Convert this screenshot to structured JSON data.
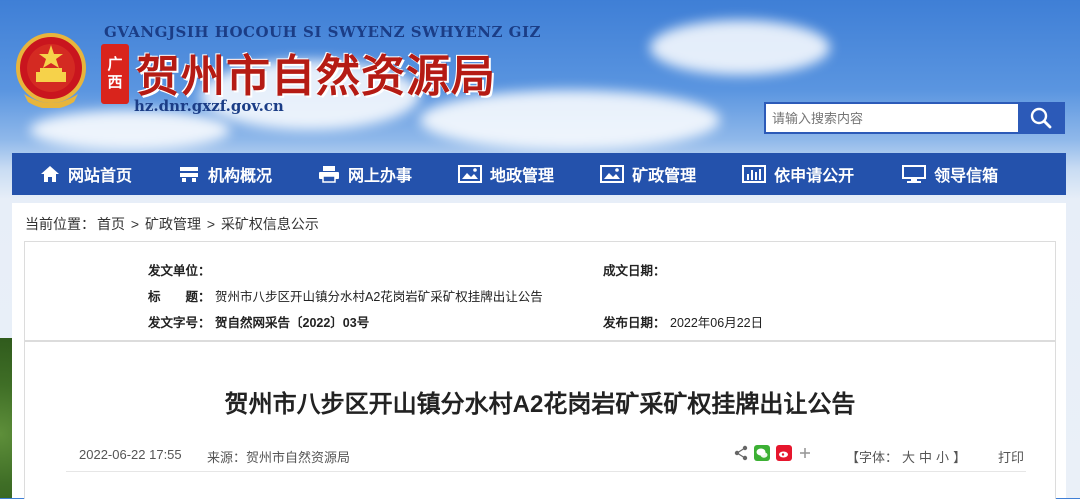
{
  "header": {
    "pinyin": "GVANGJSIH HOCOUH SI SWYENZ SWHYENZ GIZ",
    "province_tag": [
      "广",
      "西"
    ],
    "title": "贺州市自然资源局",
    "domain": "hz.dnr.gxzf.gov.cn"
  },
  "search": {
    "placeholder": "请输入搜索内容"
  },
  "nav": {
    "items": [
      {
        "label": "网站首页",
        "icon": "home-icon"
      },
      {
        "label": "机构概况",
        "icon": "building-icon"
      },
      {
        "label": "网上办事",
        "icon": "printer-icon"
      },
      {
        "label": "地政管理",
        "icon": "picture-icon"
      },
      {
        "label": "矿政管理",
        "icon": "picture-icon"
      },
      {
        "label": "依申请公开",
        "icon": "bar-chart-icon"
      },
      {
        "label": "领导信箱",
        "icon": "monitor-icon"
      }
    ]
  },
  "breadcrumb": {
    "prefix": "当前位置：",
    "items": [
      "首页",
      "矿政管理",
      "采矿权信息公示"
    ],
    "separator": ">"
  },
  "meta": {
    "issuer_label": "发文单位：",
    "issuer_value": "",
    "date_label": "成文日期：",
    "date_value": "",
    "title_label": "标　　题：",
    "title_value": "贺州市八步区开山镇分水村A2花岗岩矿采矿权挂牌出让公告",
    "docno_label": "发文字号：",
    "docno_value": "贺自然网采告〔2022〕03号",
    "publish_label": "发布日期：",
    "publish_value": "2022年06月22日"
  },
  "article": {
    "title": "贺州市八步区开山镇分水村A2花岗岩矿采矿权挂牌出让公告",
    "datetime": "2022-06-22 17:55",
    "source": "来源：贺州市自然资源局",
    "font_size_prefix": "【字体：",
    "font_sizes": [
      "大",
      "中",
      "小"
    ],
    "font_size_suffix": "】",
    "print": "打印",
    "share_icons": [
      "share-icon",
      "wechat-icon",
      "weibo-icon",
      "plus-icon"
    ]
  },
  "colors": {
    "nav_bg": "#2452ac",
    "title_red": "#b51b14",
    "accent_blue": "#2c5ab8"
  }
}
